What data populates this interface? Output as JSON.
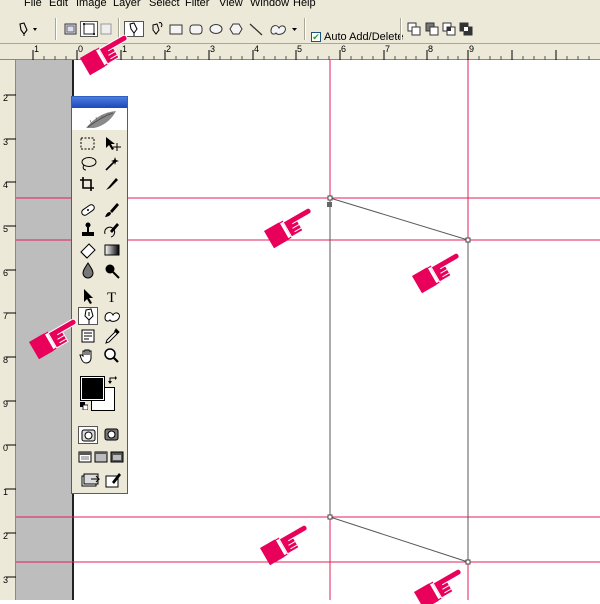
{
  "menubar": {
    "items": [
      "File",
      "Edit",
      "Image",
      "Layer",
      "Select",
      "Filter",
      "View",
      "Window",
      "Help"
    ]
  },
  "options_bar": {
    "auto_add_delete": {
      "label": "Auto Add/Delete",
      "checked": true
    },
    "tool_icons": [
      "pen-icon",
      "shape-layers-icon",
      "paths-icon",
      "fill-pixels-icon",
      "pen-icon",
      "freeform-pen-icon",
      "rectangle-icon",
      "rounded-rectangle-icon",
      "ellipse-icon",
      "polygon-icon",
      "line-icon",
      "custom-shape-icon",
      "add-to-path-icon",
      "subtract-from-path-icon",
      "intersect-path-icon",
      "exclude-path-icon"
    ]
  },
  "rulers": {
    "horizontal_labels": [
      "1",
      "0",
      "1",
      "2",
      "3",
      "4",
      "5",
      "6",
      "7",
      "8",
      "9"
    ],
    "vertical_labels": [
      "2",
      "3",
      "4",
      "5",
      "6",
      "7",
      "8",
      "9",
      "0",
      "1",
      "2",
      "3"
    ]
  },
  "toolbox": {
    "tools": [
      "rectangular-marquee-icon",
      "move-icon",
      "lasso-icon",
      "magic-wand-icon",
      "crop-icon",
      "slice-icon",
      "healing-brush-icon",
      "brush-icon",
      "clone-stamp-icon",
      "history-brush-icon",
      "eraser-icon",
      "gradient-icon",
      "blur-icon",
      "dodge-icon",
      "path-selection-icon",
      "type-icon",
      "pen-icon",
      "custom-shape-icon",
      "notes-icon",
      "eyedropper-icon",
      "hand-icon",
      "zoom-icon"
    ],
    "active_tool": "pen-icon",
    "foreground_color": "#000000",
    "background_color": "#ffffff",
    "type_label": "T"
  },
  "guides": {
    "color": "#e0205a"
  },
  "annotation": {
    "pointer_color": "#e8005a",
    "pointer_icon": "pointing-hand-icon"
  }
}
